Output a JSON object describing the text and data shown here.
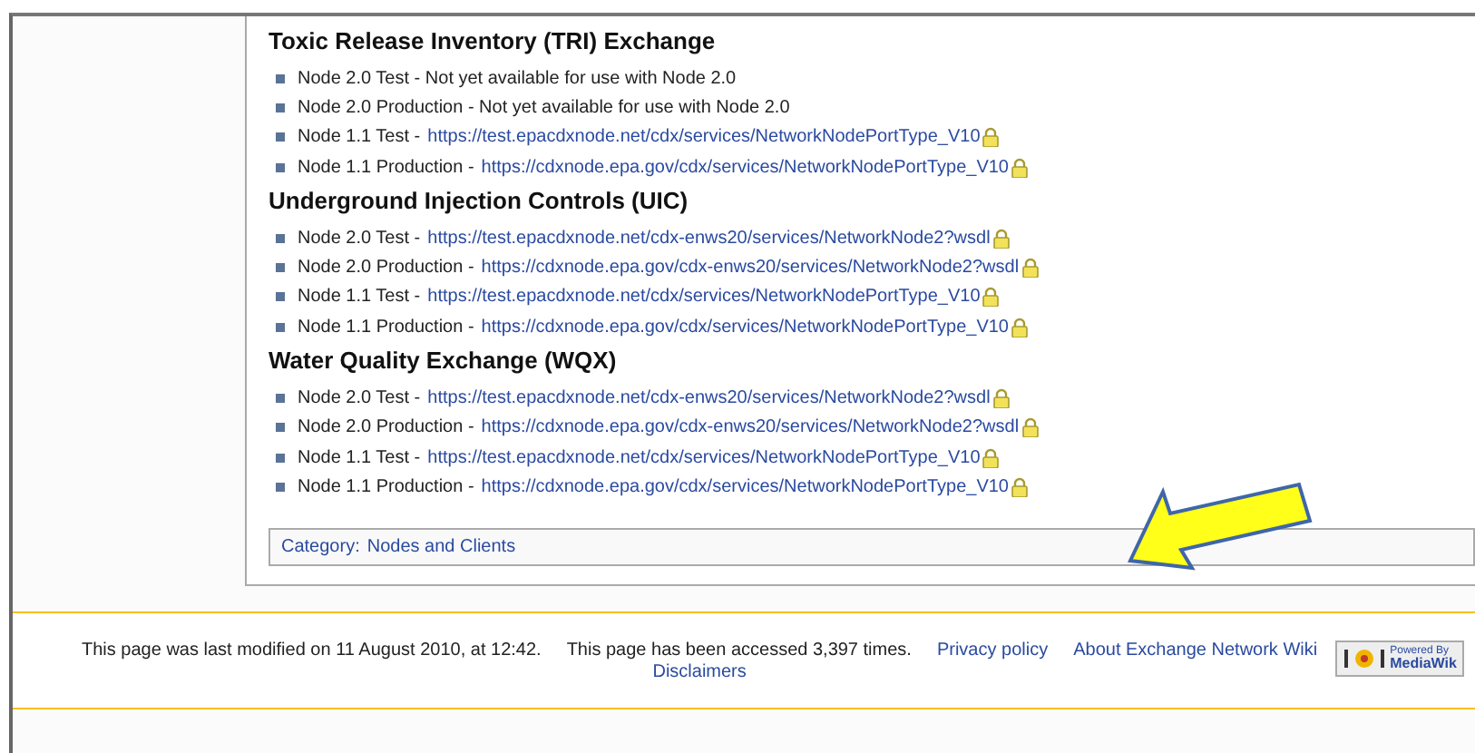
{
  "sections": [
    {
      "heading": "Toxic Release Inventory (TRI) Exchange",
      "items": [
        {
          "kind": "note",
          "label": "Node 2.0 Test -",
          "detail": "Not yet available for use with Node 2.0"
        },
        {
          "kind": "note",
          "label": "Node 2.0 Production -",
          "detail": "Not yet available for use with Node 2.0"
        },
        {
          "kind": "link",
          "label": "Node 1.1 Test -",
          "detail": "https://test.epacdxnode.net/cdx/services/NetworkNodePortType_V10"
        },
        {
          "kind": "link",
          "label": "Node 1.1 Production -",
          "detail": "https://cdxnode.epa.gov/cdx/services/NetworkNodePortType_V10"
        }
      ]
    },
    {
      "heading": "Underground Injection Controls (UIC)",
      "items": [
        {
          "kind": "link",
          "label": "Node 2.0 Test -",
          "detail": "https://test.epacdxnode.net/cdx-enws20/services/NetworkNode2?wsdl"
        },
        {
          "kind": "link",
          "label": "Node 2.0 Production -",
          "detail": "https://cdxnode.epa.gov/cdx-enws20/services/NetworkNode2?wsdl"
        },
        {
          "kind": "link",
          "label": "Node 1.1 Test -",
          "detail": "https://test.epacdxnode.net/cdx/services/NetworkNodePortType_V10"
        },
        {
          "kind": "link",
          "label": "Node 1.1 Production -",
          "detail": "https://cdxnode.epa.gov/cdx/services/NetworkNodePortType_V10"
        }
      ]
    },
    {
      "heading": "Water Quality Exchange (WQX)",
      "items": [
        {
          "kind": "link",
          "label": "Node 2.0 Test -",
          "detail": "https://test.epacdxnode.net/cdx-enws20/services/NetworkNode2?wsdl"
        },
        {
          "kind": "link",
          "label": "Node 2.0 Production -",
          "detail": "https://cdxnode.epa.gov/cdx-enws20/services/NetworkNode2?wsdl"
        },
        {
          "kind": "link",
          "label": "Node 1.1 Test -",
          "detail": "https://test.epacdxnode.net/cdx/services/NetworkNodePortType_V10"
        },
        {
          "kind": "link",
          "label": "Node 1.1 Production -",
          "detail": "https://cdxnode.epa.gov/cdx/services/NetworkNodePortType_V10"
        }
      ]
    }
  ],
  "category": {
    "label": "Category:",
    "value": "Nodes and Clients"
  },
  "footer": {
    "modified": "This page was last modified on 11 August 2010, at 12:42.",
    "accessed": "This page has been accessed 3,397 times.",
    "links": [
      "Privacy policy",
      "About Exchange Network Wiki"
    ],
    "disclaimers": "Disclaimers",
    "badge": {
      "top": "Powered By",
      "bottom": "MediaWik"
    }
  }
}
